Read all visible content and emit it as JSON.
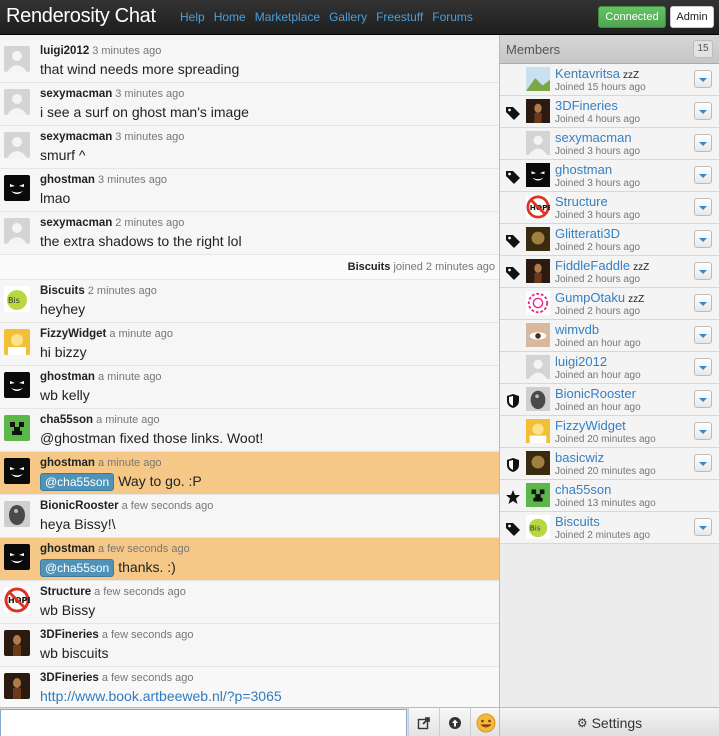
{
  "topbar": {
    "brand": "Renderosity Chat",
    "nav": [
      "Help",
      "Home",
      "Marketplace",
      "Gallery",
      "Freestuff",
      "Forums"
    ],
    "status": "Connected",
    "admin": "Admin"
  },
  "messages": [
    {
      "user": "luigi2012",
      "time": "3 minutes ago",
      "text": "that wind needs more spreading",
      "avatar": "blank-avatar"
    },
    {
      "user": "sexymacman",
      "time": "3 minutes ago",
      "text": "i see a surf on ghost man's image",
      "avatar": "blank-avatar"
    },
    {
      "user": "sexymacman",
      "time": "3 minutes ago",
      "text": "smurf ^",
      "avatar": "blank-avatar"
    },
    {
      "user": "ghostman",
      "time": "3 minutes ago",
      "text": "lmao",
      "avatar": "ghost-face-avatar"
    },
    {
      "user": "sexymacman",
      "time": "2 minutes ago",
      "text": "the extra shadows to the right lol",
      "avatar": "blank-avatar"
    }
  ],
  "join_notice": {
    "user": "Biscuits",
    "text": "joined 2 minutes ago"
  },
  "messages2": [
    {
      "user": "Biscuits",
      "time": "2 minutes ago",
      "text": "heyhey",
      "avatar": "biscuits-avatar"
    },
    {
      "user": "FizzyWidget",
      "time": "a minute ago",
      "text": "hi bizzy",
      "avatar": "homer-avatar"
    },
    {
      "user": "ghostman",
      "time": "a minute ago",
      "text": "wb kelly",
      "avatar": "ghost-face-avatar"
    },
    {
      "user": "cha55son",
      "time": "a minute ago",
      "text": "@ghostman fixed those links. Woot!",
      "avatar": "creeper-avatar"
    },
    {
      "user": "ghostman",
      "time": "a minute ago",
      "mention": "@cha55son",
      "text": "Way to go. :P",
      "avatar": "ghost-face-avatar",
      "highlight": true
    },
    {
      "user": "BionicRooster",
      "time": "a few seconds ago",
      "text": "heya Bissy!\\",
      "avatar": "rooster-avatar"
    },
    {
      "user": "ghostman",
      "time": "a few seconds ago",
      "mention": "@cha55son",
      "text": "thanks. :)",
      "avatar": "ghost-face-avatar",
      "highlight": true
    },
    {
      "user": "Structure",
      "time": "a few seconds ago",
      "text": "wb Bissy",
      "avatar": "hope-avatar"
    },
    {
      "user": "3DFineries",
      "time": "a few seconds ago",
      "text": "wb biscuits",
      "avatar": "figure-avatar"
    },
    {
      "user": "3DFineries",
      "time": "a few seconds ago",
      "link": "http://www.book.artbeeweb.nl/?p=3065",
      "avatar": "figure-avatar"
    }
  ],
  "sidebar": {
    "title": "Members",
    "count": "15",
    "members": [
      {
        "name": "Kentavritsa",
        "away": "zzZ",
        "joined": "Joined 15 hours ago",
        "badge": "",
        "avatar": "landscape-avatar",
        "menu": true
      },
      {
        "name": "3DFineries",
        "away": "",
        "joined": "Joined 4 hours ago",
        "badge": "tag-icon",
        "avatar": "figure-avatar",
        "menu": true
      },
      {
        "name": "sexymacman",
        "away": "",
        "joined": "Joined 3 hours ago",
        "badge": "",
        "avatar": "blank-avatar",
        "menu": true
      },
      {
        "name": "ghostman",
        "away": "",
        "joined": "Joined 3 hours ago",
        "badge": "tag-icon",
        "avatar": "ghost-face-avatar",
        "menu": true
      },
      {
        "name": "Structure",
        "away": "",
        "joined": "Joined 3 hours ago",
        "badge": "",
        "avatar": "hope-avatar",
        "menu": true
      },
      {
        "name": "Glitterati3D",
        "away": "",
        "joined": "Joined 2 hours ago",
        "badge": "tag-icon",
        "avatar": "dark-avatar",
        "menu": true
      },
      {
        "name": "FiddleFaddle",
        "away": "zzZ",
        "joined": "Joined 2 hours ago",
        "badge": "tag-icon",
        "avatar": "figure-avatar",
        "menu": true
      },
      {
        "name": "GumpOtaku",
        "away": "zzZ",
        "joined": "Joined 2 hours ago",
        "badge": "",
        "avatar": "pattern-avatar",
        "menu": true
      },
      {
        "name": "wimvdb",
        "away": "",
        "joined": "Joined an hour ago",
        "badge": "",
        "avatar": "eye-avatar",
        "menu": true
      },
      {
        "name": "luigi2012",
        "away": "",
        "joined": "Joined an hour ago",
        "badge": "",
        "avatar": "blank-avatar",
        "menu": true
      },
      {
        "name": "BionicRooster",
        "away": "",
        "joined": "Joined an hour ago",
        "badge": "shield-icon",
        "avatar": "rooster-avatar",
        "menu": true
      },
      {
        "name": "FizzyWidget",
        "away": "",
        "joined": "Joined 20 minutes ago",
        "badge": "",
        "avatar": "homer-avatar",
        "menu": true
      },
      {
        "name": "basicwiz",
        "away": "",
        "joined": "Joined 20 minutes ago",
        "badge": "shield-icon",
        "avatar": "dark-avatar",
        "menu": true
      },
      {
        "name": "cha55son",
        "away": "",
        "joined": "Joined 13 minutes ago",
        "badge": "star-icon",
        "avatar": "creeper-avatar",
        "menu": false
      },
      {
        "name": "Biscuits",
        "away": "",
        "joined": "Joined 2 minutes ago",
        "badge": "tag-icon",
        "avatar": "biscuits-avatar",
        "menu": true
      }
    ]
  },
  "bottom": {
    "input_value": "",
    "share_icon": "share-icon",
    "upload_icon": "upload-icon",
    "emoji_icon": "emoji-icon",
    "settings": "Settings"
  }
}
